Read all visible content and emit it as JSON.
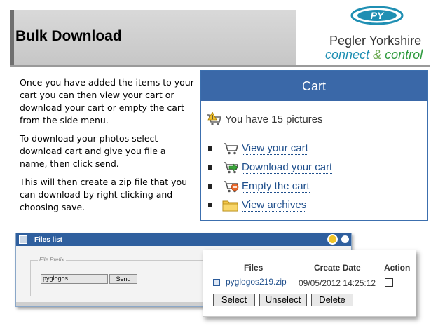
{
  "header": {
    "title": "Bulk Download",
    "logo": {
      "badge_text": "PY",
      "company": "Pegler Yorkshire",
      "tagline_connect": "connect",
      "tagline_amp": "&",
      "tagline_control": "control"
    }
  },
  "instructions": {
    "paragraphs": [
      "Once  you have added the items to your cart you can then view your cart or download your cart or empty the cart from the side menu.",
      "To download your photos select download cart and give you file a name, then click send.",
      "This will then create a zip file that you can download by right clicking and choosing save."
    ]
  },
  "cart": {
    "title": "Cart",
    "summary": "You have 15 pictures",
    "items": [
      {
        "label": "View your cart",
        "icon": "cart-view-icon"
      },
      {
        "label": "Download your cart",
        "icon": "cart-download-icon"
      },
      {
        "label": "Empty the cart",
        "icon": "cart-empty-icon"
      },
      {
        "label": "View archives",
        "icon": "folder-icon"
      }
    ]
  },
  "files_window": {
    "title": "Files list",
    "legend": "File Prefix",
    "prefix_value": "pyglogos",
    "send_label": "Send"
  },
  "files_table": {
    "columns": [
      "Files",
      "Create Date",
      "Action"
    ],
    "row": {
      "file": "pyglogos219.zip",
      "date": "09/05/2012 14:25:12"
    },
    "buttons": [
      "Select",
      "Unselect",
      "Delete"
    ]
  },
  "colors": {
    "cart_header": "#3a68a8",
    "link": "#1f4f8c",
    "titlebar": "#2f5f9e",
    "logo_blue": "#1f8fb3",
    "logo_green": "#2e9a3e"
  }
}
